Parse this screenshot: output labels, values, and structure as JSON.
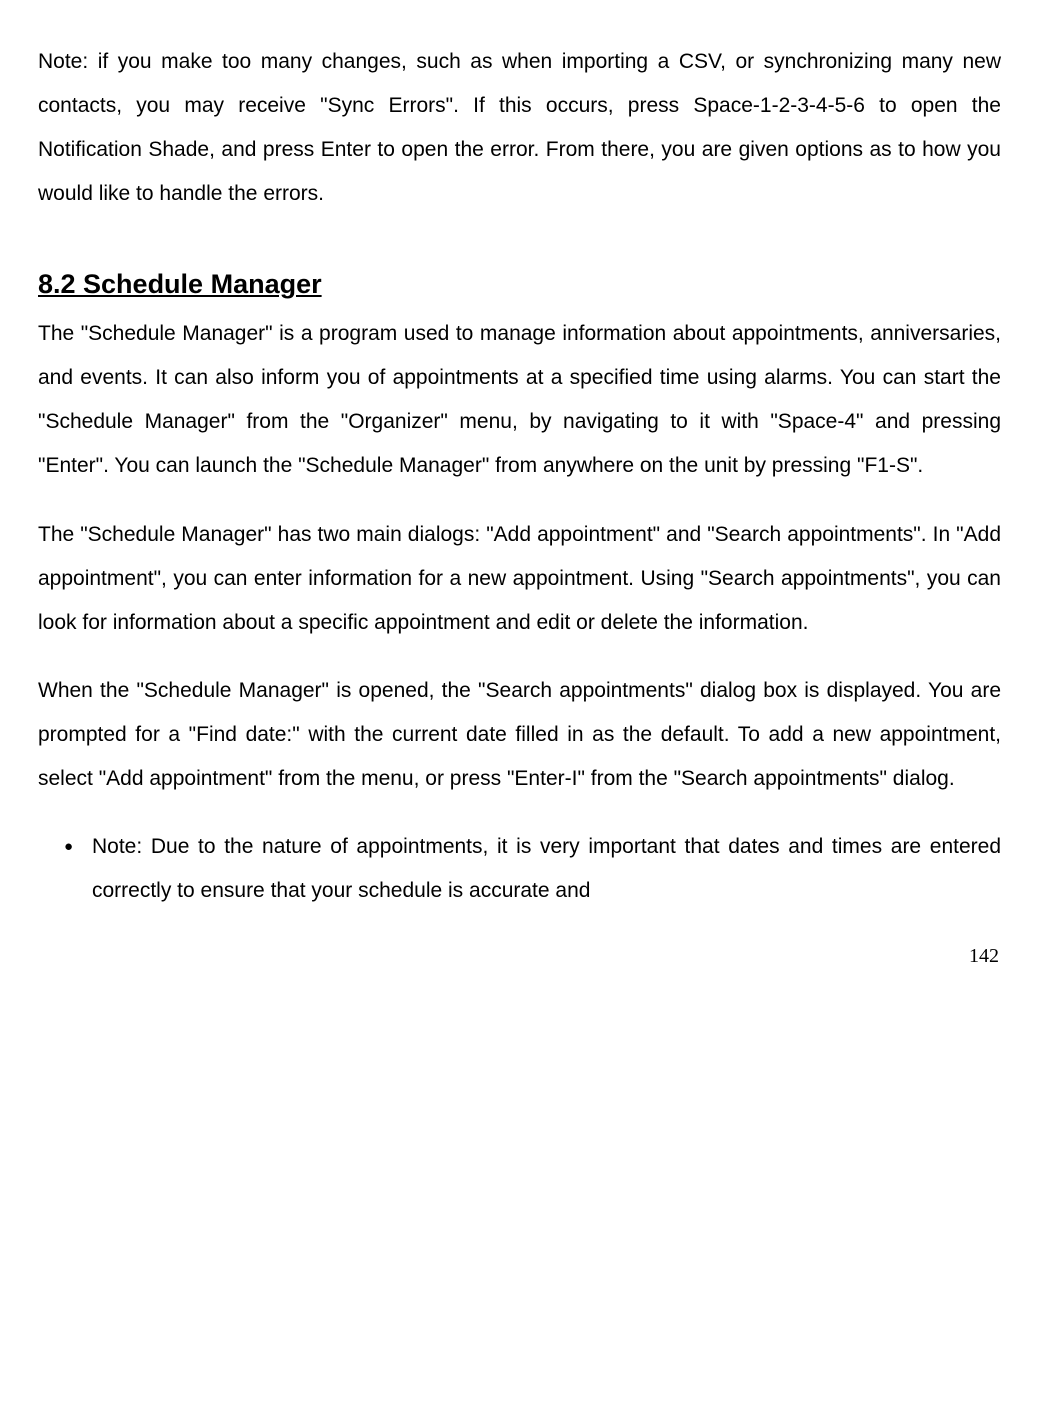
{
  "para1": "Note: if you make too many changes, such as when importing a CSV, or synchronizing many new contacts, you may receive \"Sync Errors\". If this occurs, press Space-1-2-3-4-5-6 to open the Notification Shade, and press Enter to open the error. From there, you are given options as to how you would like to handle the errors.",
  "heading": "8.2 Schedule Manager",
  "para2": "The \"Schedule Manager\" is a program used to manage information about appointments, anniversaries, and events. It can also inform you of appointments at a specified time using alarms. You can start the \"Schedule Manager\" from the \"Organizer\" menu, by navigating to it with \"Space-4\" and pressing \"Enter\". You can launch the \"Schedule Manager\" from anywhere on the unit by pressing \"F1-S\".",
  "para3": "The \"Schedule Manager\" has two main dialogs: \"Add appointment\" and \"Search appointments\". In \"Add appointment\", you can enter information for a new appointment. Using \"Search appointments\", you can look for information about a specific appointment and edit or delete the information.",
  "para4": "When the \"Schedule Manager\" is opened, the \"Search appointments\" dialog box is displayed. You are prompted for a \"Find date:\" with the current date filled in as the default. To add a new appointment, select \"Add appointment\" from the menu, or press \"Enter-I\" from the \"Search appointments\" dialog.",
  "bullet1": "Note: Due to the nature of appointments, it is very important that dates and times are entered correctly to ensure that your schedule is accurate and",
  "pageNumber": "142"
}
